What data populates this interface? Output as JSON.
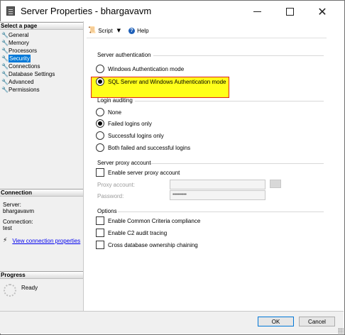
{
  "window": {
    "title": "Server Properties - bhargavavm"
  },
  "left_panel": {
    "select_page_header": "Select a page",
    "pages": [
      {
        "label": "General"
      },
      {
        "label": "Memory"
      },
      {
        "label": "Processors"
      },
      {
        "label": "Security",
        "selected": true
      },
      {
        "label": "Connections"
      },
      {
        "label": "Database Settings"
      },
      {
        "label": "Advanced"
      },
      {
        "label": "Permissions"
      }
    ],
    "connection_header": "Connection",
    "server_label": "Server:",
    "server_value": "bhargavavm",
    "connection_label": "Connection:",
    "connection_value": "test",
    "view_connection_link": "View connection properties",
    "progress_header": "Progress",
    "progress_status": "Ready"
  },
  "toolbar": {
    "script_label": "Script",
    "help_label": "Help"
  },
  "server_authentication": {
    "group_label": "Server authentication",
    "options": [
      {
        "label": "Windows Authentication mode",
        "selected": false
      },
      {
        "label": "SQL Server and Windows Authentication mode",
        "selected": true
      }
    ]
  },
  "login_auditing": {
    "group_label": "Login auditing",
    "options": [
      {
        "label": "None",
        "selected": false
      },
      {
        "label": "Failed logins only",
        "selected": true
      },
      {
        "label": "Successful logins only",
        "selected": false
      },
      {
        "label": "Both failed and successful logins",
        "selected": false
      }
    ]
  },
  "proxy": {
    "group_label": "Server proxy account",
    "enable_label": "Enable server proxy account",
    "enabled": false,
    "account_label": "Proxy account:",
    "account_value": "",
    "password_label": "Password:",
    "password_value": "••••••••••"
  },
  "options": {
    "group_label": "Options",
    "items": [
      {
        "label": "Enable Common Criteria compliance",
        "checked": false
      },
      {
        "label": "Enable C2 audit tracing",
        "checked": false
      },
      {
        "label": "Cross database ownership chaining",
        "checked": false
      }
    ]
  },
  "buttons": {
    "ok": "OK",
    "cancel": "Cancel"
  },
  "colors": {
    "highlight": "#ffff1a",
    "highlight_border": "#dd2222",
    "selection": "#0078d7"
  }
}
